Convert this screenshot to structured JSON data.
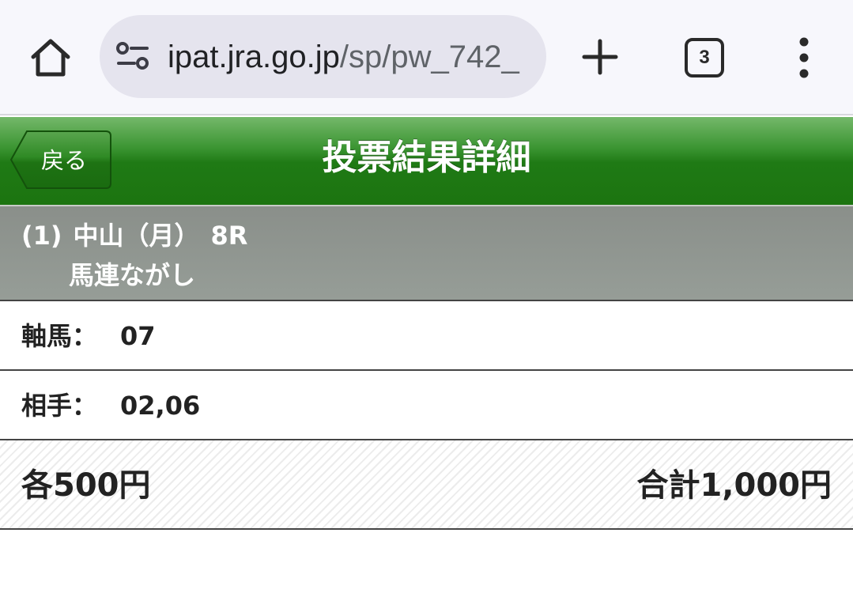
{
  "browser": {
    "url_host": "ipat.jra.go.jp",
    "url_path": "/sp/pw_742_",
    "tab_count": "3",
    "icons": [
      "home-icon",
      "site-info-icon",
      "plus-icon",
      "tabs-icon",
      "more-vertical-icon"
    ]
  },
  "header": {
    "back_label": "戻る",
    "title": "投票結果詳細",
    "colors": {
      "top": "#74b86a",
      "bottom": "#1c7410"
    }
  },
  "race": {
    "number": "(1)",
    "venue": "中山（月）",
    "race": "8R",
    "bet_type": "馬連ながし"
  },
  "details": {
    "axis_label": "軸馬：",
    "axis_value": "07",
    "partner_label": "相手：",
    "partner_value": "02,06"
  },
  "amount": {
    "each": "各500円",
    "total": "合計1,000円"
  }
}
